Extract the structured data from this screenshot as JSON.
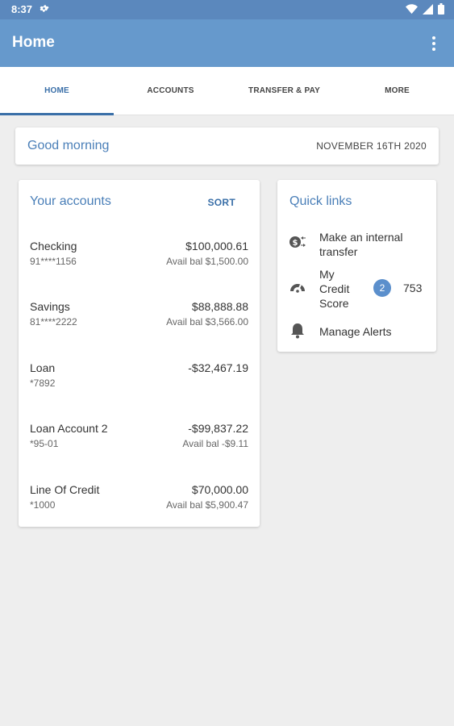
{
  "status_bar": {
    "time": "8:37"
  },
  "app_bar": {
    "title": "Home"
  },
  "tabs": [
    {
      "label": "HOME",
      "active": true
    },
    {
      "label": "ACCOUNTS",
      "active": false
    },
    {
      "label": "TRANSFER & PAY",
      "active": false
    },
    {
      "label": "MORE",
      "active": false
    }
  ],
  "greeting": {
    "text": "Good morning",
    "date": "NOVEMBER 16TH 2020"
  },
  "accounts": {
    "title": "Your accounts",
    "sort_label": "SORT",
    "items": [
      {
        "name": "Checking",
        "number": "91****1156",
        "balance": "$100,000.61",
        "avail": "Avail bal $1,500.00"
      },
      {
        "name": "Savings",
        "number": "81****2222",
        "balance": "$88,888.88",
        "avail": "Avail bal $3,566.00"
      },
      {
        "name": "Loan",
        "number": "*7892",
        "balance": "-$32,467.19",
        "avail": ""
      },
      {
        "name": "Loan Account 2",
        "number": "*95-01",
        "balance": "-$99,837.22",
        "avail": "Avail bal -$9.11"
      },
      {
        "name": "Line Of Credit",
        "number": "*1000",
        "balance": "$70,000.00",
        "avail": "Avail bal $5,900.47"
      }
    ]
  },
  "quick_links": {
    "title": "Quick links",
    "transfer": {
      "line1": "Make an internal",
      "line2": "transfer",
      "icon": "transfer-icon"
    },
    "credit": {
      "line1": "My",
      "line2": "Credit",
      "line3": "Score",
      "badge": "2",
      "score": "753",
      "icon": "gauge-icon"
    },
    "alerts": {
      "label": "Manage Alerts",
      "icon": "bell-icon"
    }
  },
  "colors": {
    "primary": "#6699cc",
    "status": "#5b88bd",
    "accent": "#3a6fa8",
    "badge": "#5b8fcc"
  }
}
